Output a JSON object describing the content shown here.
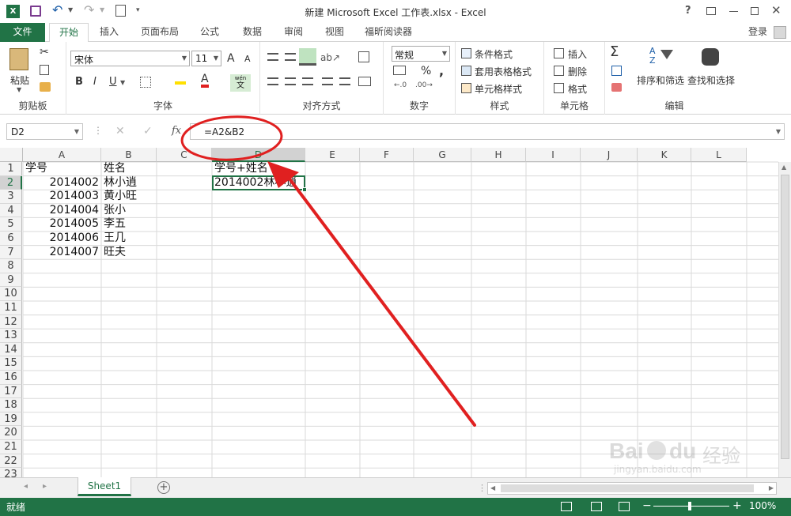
{
  "window": {
    "title": "新建 Microsoft Excel 工作表.xlsx - Excel",
    "help": "?",
    "login": "登录"
  },
  "tabs": [
    "文件",
    "开始",
    "插入",
    "页面布局",
    "公式",
    "数据",
    "审阅",
    "视图",
    "福昕阅读器"
  ],
  "ribbon": {
    "clipboard": {
      "paste": "粘贴",
      "label": "剪贴板"
    },
    "font": {
      "name": "宋体",
      "size": "11",
      "grow": "A",
      "shrink": "A",
      "bold": "B",
      "italic": "I",
      "underline": "U",
      "label": "字体",
      "phonetic_top": "wén",
      "phonetic_bottom": "文"
    },
    "alignment": {
      "label": "对齐方式"
    },
    "number": {
      "format": "常规",
      "percent": "%",
      "comma": ",",
      "label": "数字"
    },
    "styles": {
      "conditional": "条件格式",
      "table": "套用表格格式",
      "cell": "单元格样式",
      "label": "样式"
    },
    "cells": {
      "insert": "插入",
      "delete": "删除",
      "format": "格式",
      "label": "单元格"
    },
    "editing": {
      "sort": "排序和筛选",
      "find": "查找和选择",
      "label": "编辑",
      "az_top": "A",
      "az_bottom": "Z"
    }
  },
  "formula_bar": {
    "name_box": "D2",
    "fx": "fx",
    "formula": "=A2&B2"
  },
  "columns": [
    "A",
    "B",
    "C",
    "D",
    "E",
    "F",
    "G",
    "H",
    "I",
    "J",
    "K",
    "L"
  ],
  "rows": [
    "1",
    "2",
    "3",
    "4",
    "5",
    "6",
    "7",
    "8",
    "9",
    "10",
    "11",
    "12",
    "13",
    "14",
    "15",
    "16",
    "17",
    "18",
    "19",
    "20",
    "21",
    "22",
    "23"
  ],
  "cells": {
    "A1": "学号",
    "B1": "姓名",
    "D1": "学号+姓名",
    "A2": "2014002",
    "B2": "林小逍",
    "D2": "2014002林小逍",
    "A3": "2014003",
    "B3": "黄小旺",
    "A4": "2014004",
    "B4": "张小",
    "A5": "2014005",
    "B5": "李五",
    "A6": "2014006",
    "B6": "王几",
    "A7": "2014007",
    "B7": "旺夫"
  },
  "sheet_tab": "Sheet1",
  "status": {
    "ready": "就绪",
    "zoom": "100%",
    "minus": "−",
    "plus": "+"
  },
  "watermark": {
    "text": "Bai",
    "text2": "du",
    "cn": "经验",
    "url": "jingyan.baidu.com"
  },
  "colors": {
    "excel_green": "#217346",
    "annotation_red": "#e02020"
  }
}
